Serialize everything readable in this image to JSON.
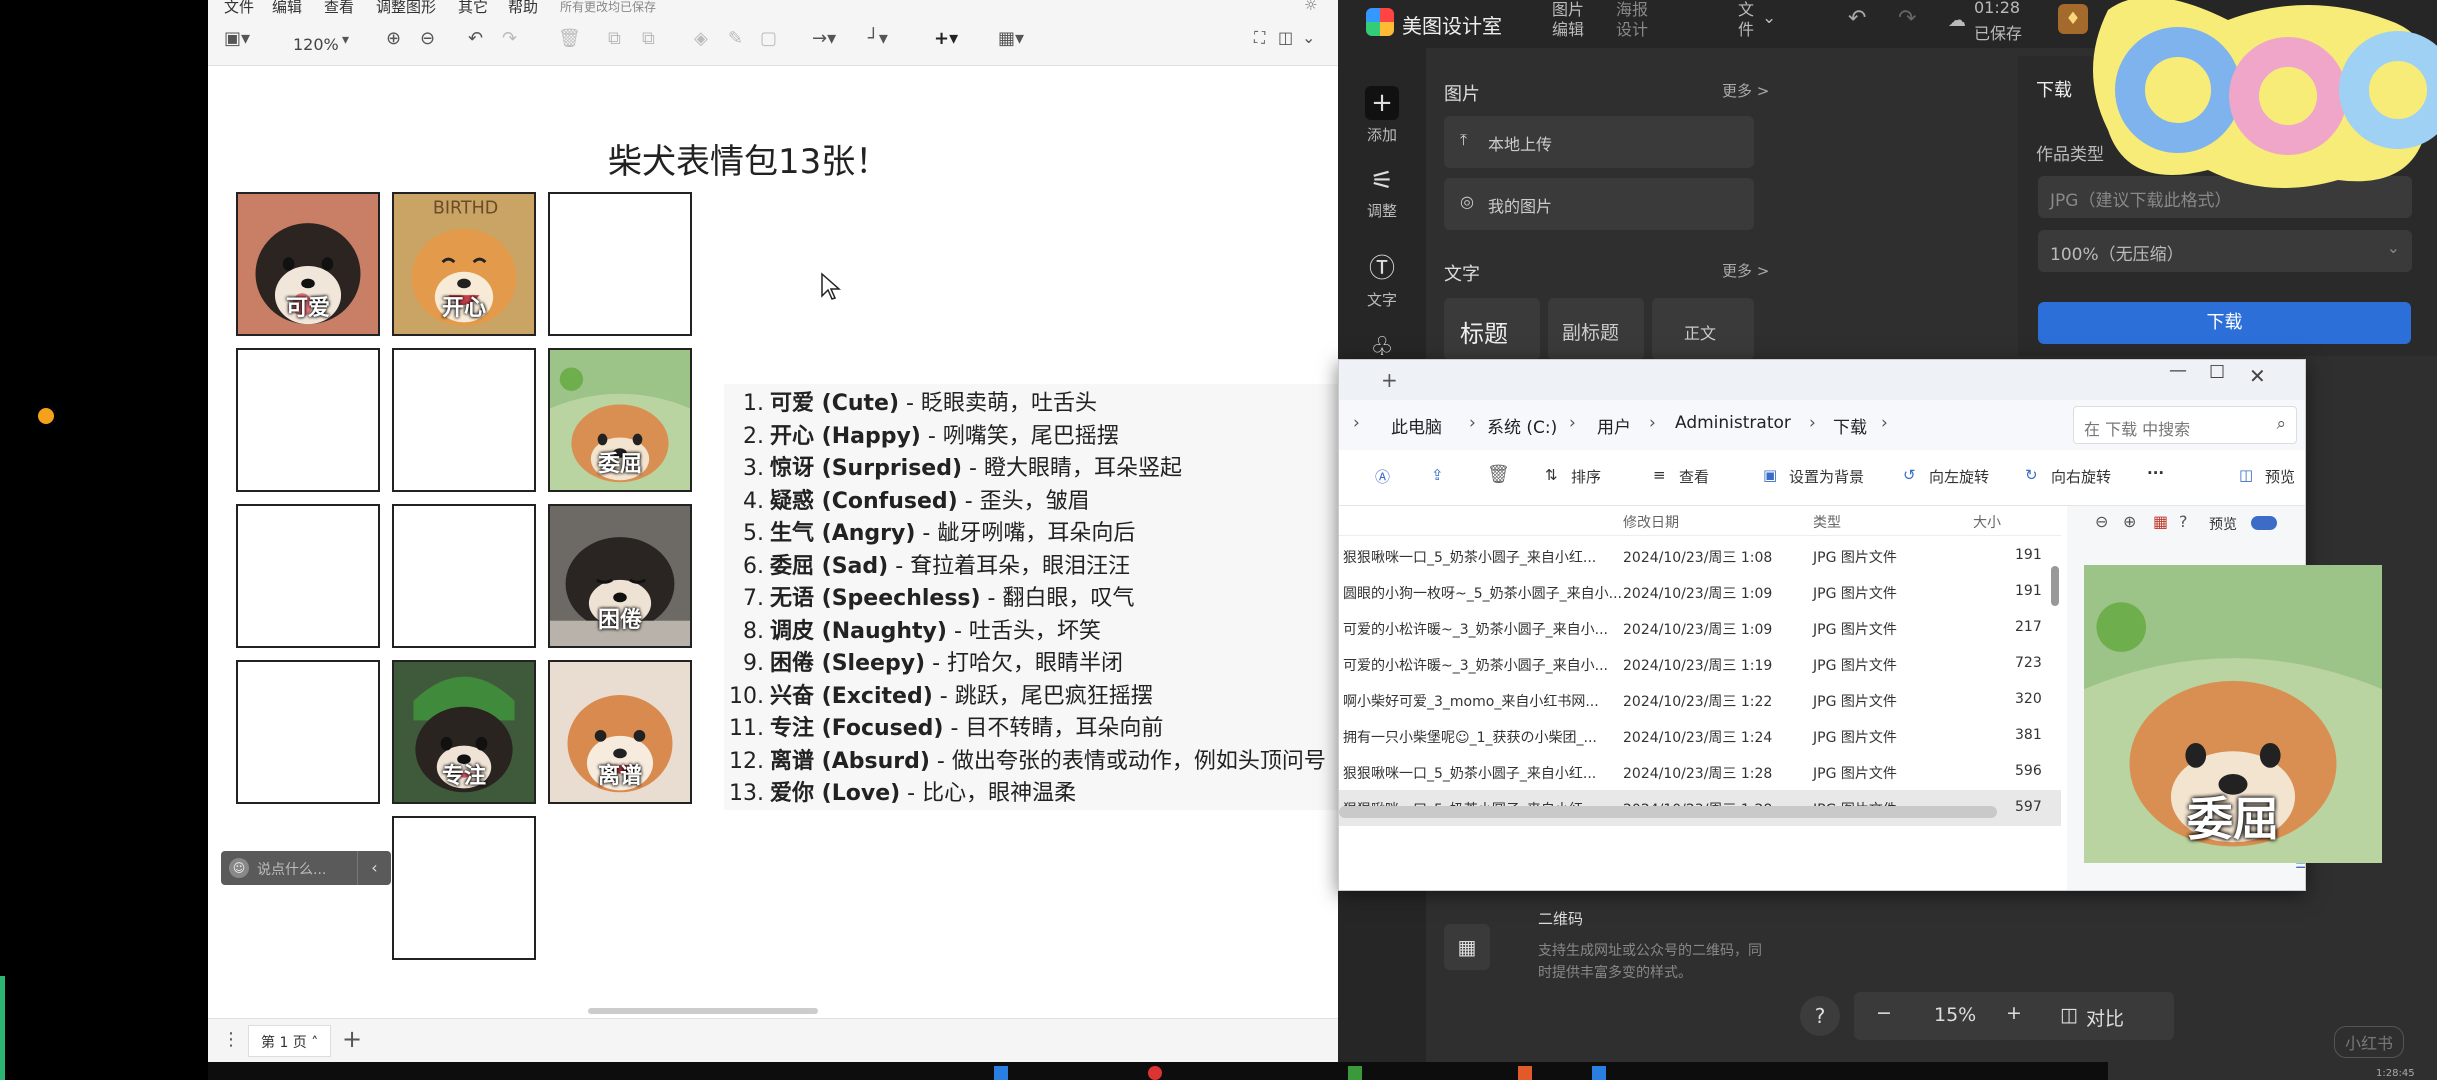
{
  "editor": {
    "menu": [
      "文件",
      "编辑",
      "查看",
      "调整图形",
      "其它",
      "帮助"
    ],
    "save_status": "所有更改均已保存",
    "zoom": "120%",
    "title": "柴犬表情包13张！",
    "captions": {
      "cute": "可爱",
      "happy": "开心",
      "sad": "委屈",
      "sleepy": "困倦",
      "focused": "专注",
      "absurd": "离谱"
    },
    "list": [
      {
        "num": "1.",
        "name": "可爱 (Cute)",
        "desc": " - 眨眼卖萌，吐舌头"
      },
      {
        "num": "2.",
        "name": "开心 (Happy)",
        "desc": " - 咧嘴笑，尾巴摇摆"
      },
      {
        "num": "3.",
        "name": "惊讶 (Surprised)",
        "desc": " - 瞪大眼睛，耳朵竖起"
      },
      {
        "num": "4.",
        "name": "疑惑 (Confused)",
        "desc": " - 歪头，皱眉"
      },
      {
        "num": "5.",
        "name": "生气 (Angry)",
        "desc": " - 龇牙咧嘴，耳朵向后"
      },
      {
        "num": "6.",
        "name": "委屈 (Sad)",
        "desc": " - 耷拉着耳朵，眼泪汪汪"
      },
      {
        "num": "7.",
        "name": "无语 (Speechless)",
        "desc": " - 翻白眼，叹气"
      },
      {
        "num": "8.",
        "name": "调皮 (Naughty)",
        "desc": " - 吐舌头，坏笑"
      },
      {
        "num": "9.",
        "name": "困倦 (Sleepy)",
        "desc": " - 打哈欠，眼睛半闭"
      },
      {
        "num": "10.",
        "name": "兴奋 (Excited)",
        "desc": " - 跳跃，尾巴疯狂摇摆"
      },
      {
        "num": "11.",
        "name": "专注 (Focused)",
        "desc": " - 目不转睛，耳朵向前"
      },
      {
        "num": "12.",
        "name": "离谱 (Absurd)",
        "desc": " - 做出夸张的表情或动作，例如头顶问号"
      },
      {
        "num": "13.",
        "name": "爱你 (Love)",
        "desc": " - 比心，眼神温柔"
      }
    ],
    "chat_placeholder": "说点什么...",
    "page_tab": "第 1 页",
    "add_page": "+"
  },
  "meitu": {
    "app_name": "美图设计室",
    "tabs": [
      "图片编辑",
      "海报设计",
      "文件"
    ],
    "time": "01:28",
    "saved": "已保存",
    "nav": [
      "添加",
      "调整",
      "文字"
    ],
    "image_section": "图片",
    "more": "更多 >",
    "local_upload": "本地上传",
    "my_images": "我的图片",
    "text_section": "文字",
    "title_style": "标题",
    "subtitle_style": "副标题",
    "body_style": "正文",
    "download_title": "下载",
    "type_label": "作品类型",
    "format_value": "JPG（建议下载此格式）",
    "quality_value": "100%（无压缩）",
    "download_button": "下载",
    "qr_title": "二维码",
    "qr_desc": "支持生成网址或公众号的二维码，同时提供丰富多变的样式。",
    "zoom": "15%",
    "compare": "对比",
    "help": "?",
    "zoom_out": "−",
    "zoom_in": "+",
    "watermark": "小红书",
    "corner_time": "1:28:45"
  },
  "explorer": {
    "new_tab": "+",
    "breadcrumb": [
      "此电脑",
      "系统 (C:)",
      "用户",
      "Administrator",
      "下载"
    ],
    "search_placeholder": "在 下载 中搜索",
    "commands": [
      "排序",
      "查看",
      "设置为背景",
      "向左旋转",
      "向右旋转",
      "···",
      "预览"
    ],
    "columns": [
      "修改日期",
      "类型",
      "大小"
    ],
    "rows": [
      {
        "name": "狠狠啾咪一口_5_奶茶小圆子_来自小红...",
        "date": "2024/10/23/周三 1:08",
        "type": "JPG 图片文件",
        "size": "191"
      },
      {
        "name": "圆眼的小狗一枚呀~_5_奶茶小圆子_来自小...",
        "date": "2024/10/23/周三 1:09",
        "type": "JPG 图片文件",
        "size": "191"
      },
      {
        "name": "可爱的小松许暖~_3_奶茶小圆子_来自小...",
        "date": "2024/10/23/周三 1:09",
        "type": "JPG 图片文件",
        "size": "217"
      },
      {
        "name": "可爱的小松许暖~_3_奶茶小圆子_来自小...",
        "date": "2024/10/23/周三 1:19",
        "type": "JPG 图片文件",
        "size": "723"
      },
      {
        "name": "啊小柴好可爱_3_momo_来自小红书网...",
        "date": "2024/10/23/周三 1:22",
        "type": "JPG 图片文件",
        "size": "320"
      },
      {
        "name": "拥有一只小柴堡呢☺_1_获获の小柴团_...",
        "date": "2024/10/23/周三 1:24",
        "type": "JPG 图片文件",
        "size": "381"
      },
      {
        "name": "狠狠啾咪一口_5_奶茶小圆子_来自小红...",
        "date": "2024/10/23/周三 1:28",
        "type": "JPG 图片文件",
        "size": "596"
      },
      {
        "name": "狠狠啾咪一口_5_奶茶小圆子_来自小红...",
        "date": "2024/10/23/周三 1:28",
        "type": "JPG 图片文件",
        "size": "597"
      }
    ],
    "preview_label": "预览",
    "preview_caption": "委屈"
  },
  "colors": {
    "accent_blue": "#2d6fd8",
    "orange_dot": "#f5a11c",
    "green_edge": "#2bb673"
  }
}
